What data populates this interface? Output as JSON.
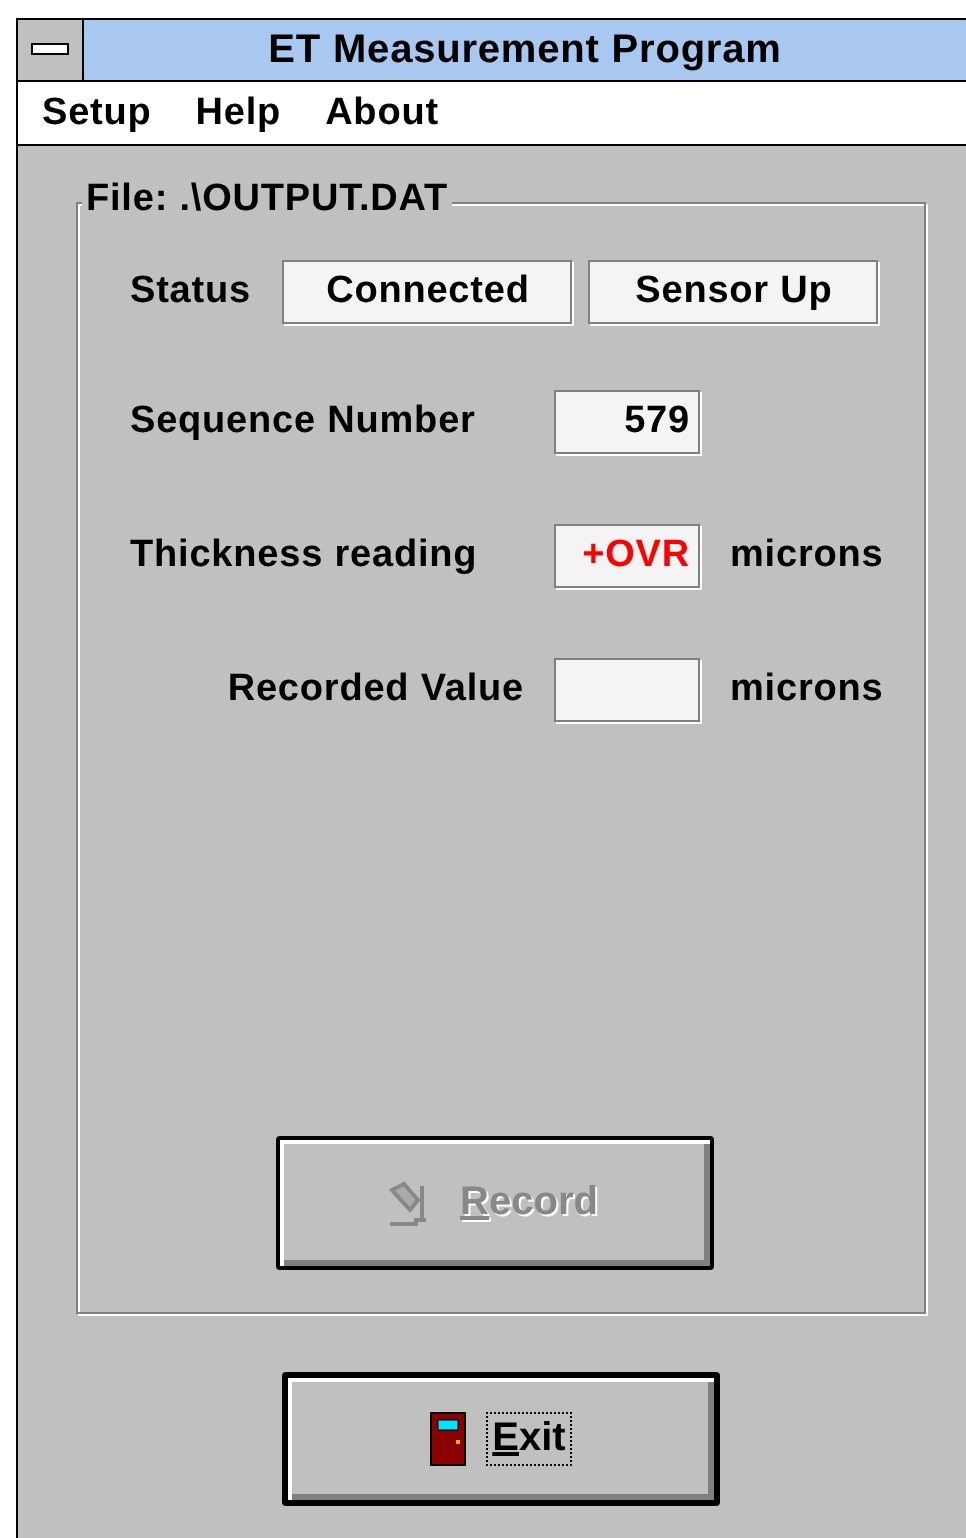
{
  "window": {
    "title": "ET Measurement Program"
  },
  "menu": [
    {
      "label": "Setup"
    },
    {
      "label": "Help"
    },
    {
      "label": "About"
    }
  ],
  "file_group": {
    "label": "File: .\\OUTPUT.DAT",
    "status": {
      "label": "Status",
      "values": [
        "Connected",
        "Sensor Up"
      ]
    },
    "fields": [
      {
        "label": "Sequence Number",
        "value": "579",
        "alert": false
      },
      {
        "label": "Thickness reading",
        "value": "+OVR",
        "unit": "microns",
        "alert": true
      },
      {
        "label": "Recorded Value",
        "unit": "microns"
      }
    ],
    "record_button": {
      "label": "Record",
      "disabled": true
    }
  },
  "exit_button": {
    "label": "Exit",
    "focused": true
  }
}
